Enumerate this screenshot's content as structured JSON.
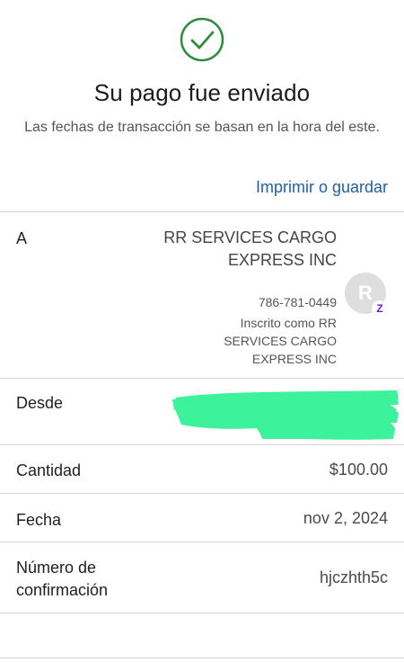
{
  "header": {
    "status_icon": "checkmark-circle-icon",
    "title": "Su pago fue enviado",
    "subtitle": "Las fechas de transacción se basan en la hora del este.",
    "print_link": "Imprimir o guardar",
    "accent_color": "#2e8b3e",
    "link_color": "#1e5fa8"
  },
  "recipient": {
    "label": "A",
    "name": "RR SERVICES CARGO EXPRESS INC",
    "phone": "786-781-0449",
    "enrolled_as": "Inscrito como RR SERVICES CARGO EXPRESS INC",
    "avatar_initial": "R",
    "badge_icon": "zelle-icon",
    "badge_glyph": "Z"
  },
  "from": {
    "label": "Desde"
  },
  "details": [
    {
      "label": "Cantidad",
      "value": "$100.00"
    },
    {
      "label": "Fecha",
      "value": "nov 2, 2024"
    },
    {
      "label": "Número de confirmación",
      "value": "hjczhth5c"
    }
  ]
}
